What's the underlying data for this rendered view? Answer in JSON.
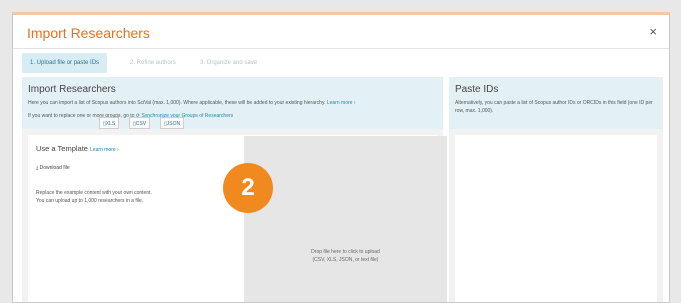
{
  "modal": {
    "title": "Import Researchers",
    "close_label": "×"
  },
  "steps": [
    {
      "label": "1. Upload file or paste IDs",
      "active": true
    },
    {
      "label": "2. Refine authors",
      "active": false
    },
    {
      "label": "3. Organize and save",
      "active": false
    }
  ],
  "import_panel": {
    "heading": "Import Researchers",
    "desc_1": "Here you can import a list of Scopus authors into SciVal (max. 1,000). Where applicable, these will be added to your existing hierarchy.",
    "learn_more": "Learn more ›",
    "desc_2": "If you want to replace one or more groups, go to",
    "sync_link": "Synchronize your Groups of Researchers"
  },
  "template": {
    "heading": "Use a Template",
    "learn_more": "Learn more ›",
    "download_label": "Download file",
    "formats": [
      "XLS",
      "CSV",
      "JSON"
    ],
    "note_1": "Replace the example content with your own content.",
    "note_2": "You can upload up to 1,000 researchers in a file."
  },
  "dropzone": {
    "line_1": "Drop file here to click to upload",
    "line_2": "(CSV, XLS, JSON, or text file)"
  },
  "paste_panel": {
    "heading": "Paste IDs",
    "desc": "Alternatively, you can paste a list of Scopus author IDs or ORCIDs in this field (one ID per row, max. 1,000)."
  },
  "callout": {
    "number": "2"
  },
  "colors": {
    "accent": "#e9711c",
    "link": "#2b83a8",
    "badge": "#f08a1e",
    "info_bg": "#e3f1f6"
  }
}
